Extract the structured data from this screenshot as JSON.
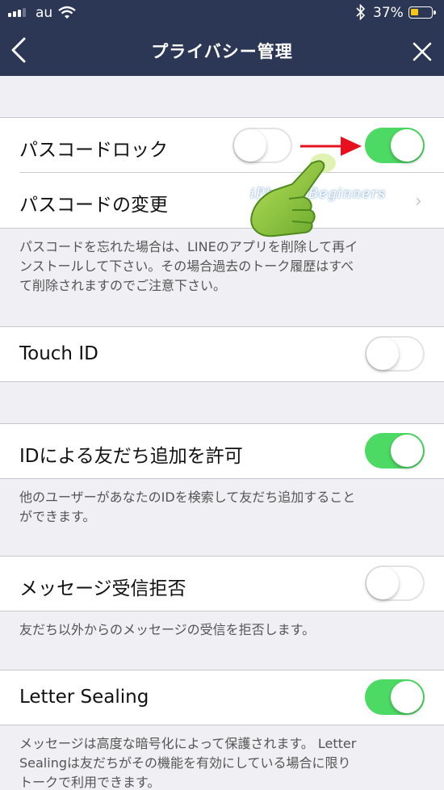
{
  "status_bar": {
    "carrier": "au",
    "battery_percent": "37%",
    "battery_color": "#f5c518"
  },
  "nav": {
    "title": "プライバシー管理",
    "bg_color": "#2b3755"
  },
  "passcode": {
    "lock_label": "パスコードロック",
    "lock_on": true,
    "change_label": "パスコードの変更",
    "note_lines": [
      "パスコードを忘れた場合は、LINEのアプリを削除して再イ",
      "ンストールして下さい。その場合過去のトーク履歴はすべ",
      "て削除されますのでご注意下さい。"
    ]
  },
  "touch_id": {
    "label": "Touch ID",
    "on": false
  },
  "id_add": {
    "label": "IDによる友だち追加を許可",
    "on": true,
    "note_lines": [
      "他のユーザーがあなたのIDを検索して友だち追加すること",
      "ができます。"
    ]
  },
  "reject": {
    "label": "メッセージ受信拒否",
    "on": false,
    "note_lines": [
      "友だち以外からのメッセージの受信を拒否します。"
    ]
  },
  "letter_sealing": {
    "label": "Letter Sealing",
    "on": true,
    "note_lines": [
      "メッセージは高度な暗号化によって保護されます。 Letter",
      "Sealingは友だちがその機能を有効にしている場合に限り",
      "トークで利用できます。"
    ]
  },
  "watermark": "iPhone Beginners",
  "colors": {
    "toggle_on": "#4cd964",
    "arrow": "#e8101f",
    "hand": "#8cc63f"
  }
}
